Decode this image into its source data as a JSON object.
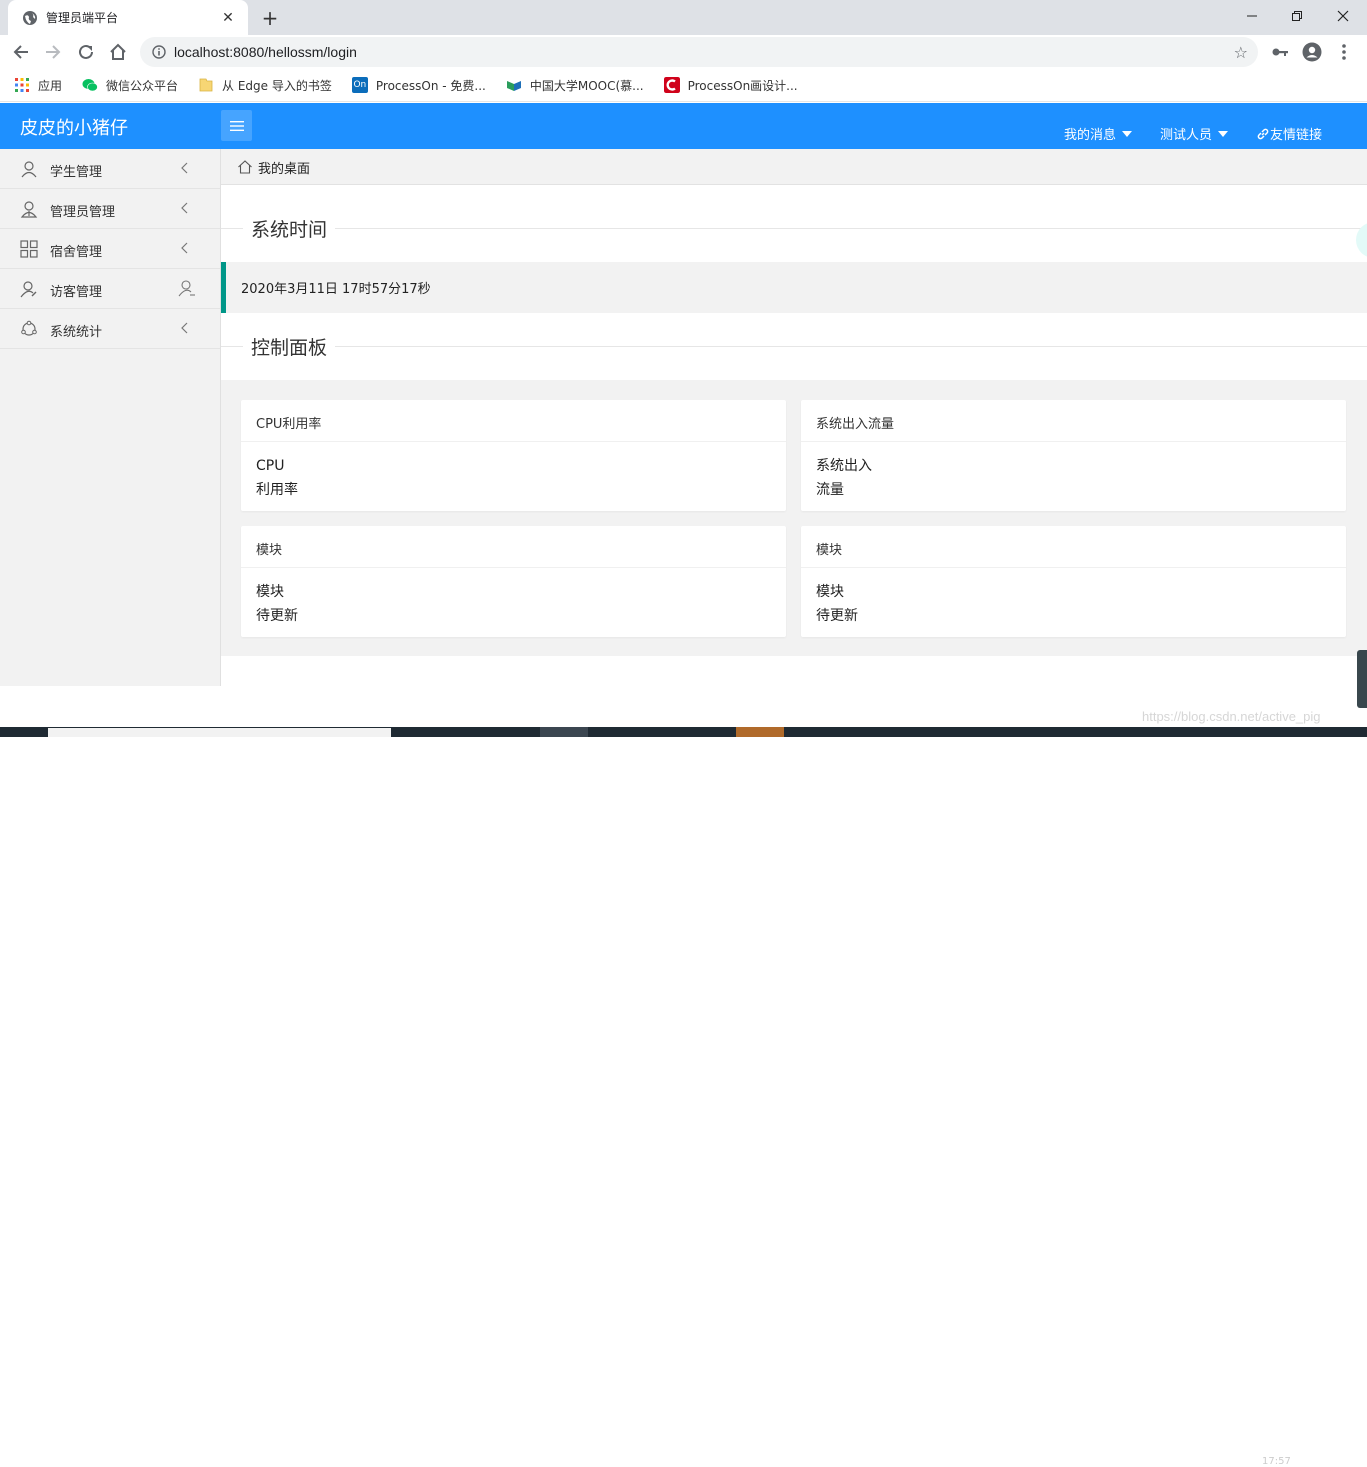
{
  "browser": {
    "tab_title": "管理员端平台",
    "url": "localhost:8080/hellossm/login",
    "bookmarks": [
      {
        "label": "应用",
        "icon": "apps-grid-icon",
        "color": "#ea4335"
      },
      {
        "label": "微信公众平台",
        "icon": "wechat-icon",
        "color": "#07c160"
      },
      {
        "label": "从 Edge 导入的书签",
        "icon": "folder-icon",
        "color": "#f5c542"
      },
      {
        "label": "ProcessOn - 免费...",
        "icon": "processon-icon",
        "color": "#0b6dbb"
      },
      {
        "label": "中国大学MOOC(慕...",
        "icon": "mooc-icon",
        "color": "#2a9d5c"
      },
      {
        "label": "ProcessOn画设计...",
        "icon": "processon-red-icon",
        "color": "#d0021b"
      }
    ]
  },
  "header": {
    "logo": "皮皮的小猪仔",
    "messages": "我的消息",
    "user": "测试人员",
    "links": "友情链接",
    "color": "#1e90ff"
  },
  "sidebar": {
    "items": [
      {
        "label": "学生管理",
        "icon": "user-icon"
      },
      {
        "label": "管理员管理",
        "icon": "admin-icon"
      },
      {
        "label": "宿舍管理",
        "icon": "grid-icon"
      },
      {
        "label": "访客管理",
        "icon": "visitor-icon"
      },
      {
        "label": "系统统计",
        "icon": "stats-icon"
      }
    ]
  },
  "main": {
    "breadcrumb": "我的桌面",
    "time_section": "系统时间",
    "time_value": "2020年3月11日 17时57分17秒",
    "panel_section": "控制面板",
    "cards": [
      {
        "title": "CPU利用率",
        "line1": "CPU",
        "line2": "利用率"
      },
      {
        "title": "系统出入流量",
        "line1": "系统出入",
        "line2": "流量"
      },
      {
        "title": "模块",
        "line1": "模块",
        "line2": "待更新"
      },
      {
        "title": "模块",
        "line1": "模块",
        "line2": "待更新"
      }
    ],
    "accent": "#009688"
  },
  "watermark": "https://blog.csdn.net/active_pig",
  "taskbar_clock": "17:57"
}
